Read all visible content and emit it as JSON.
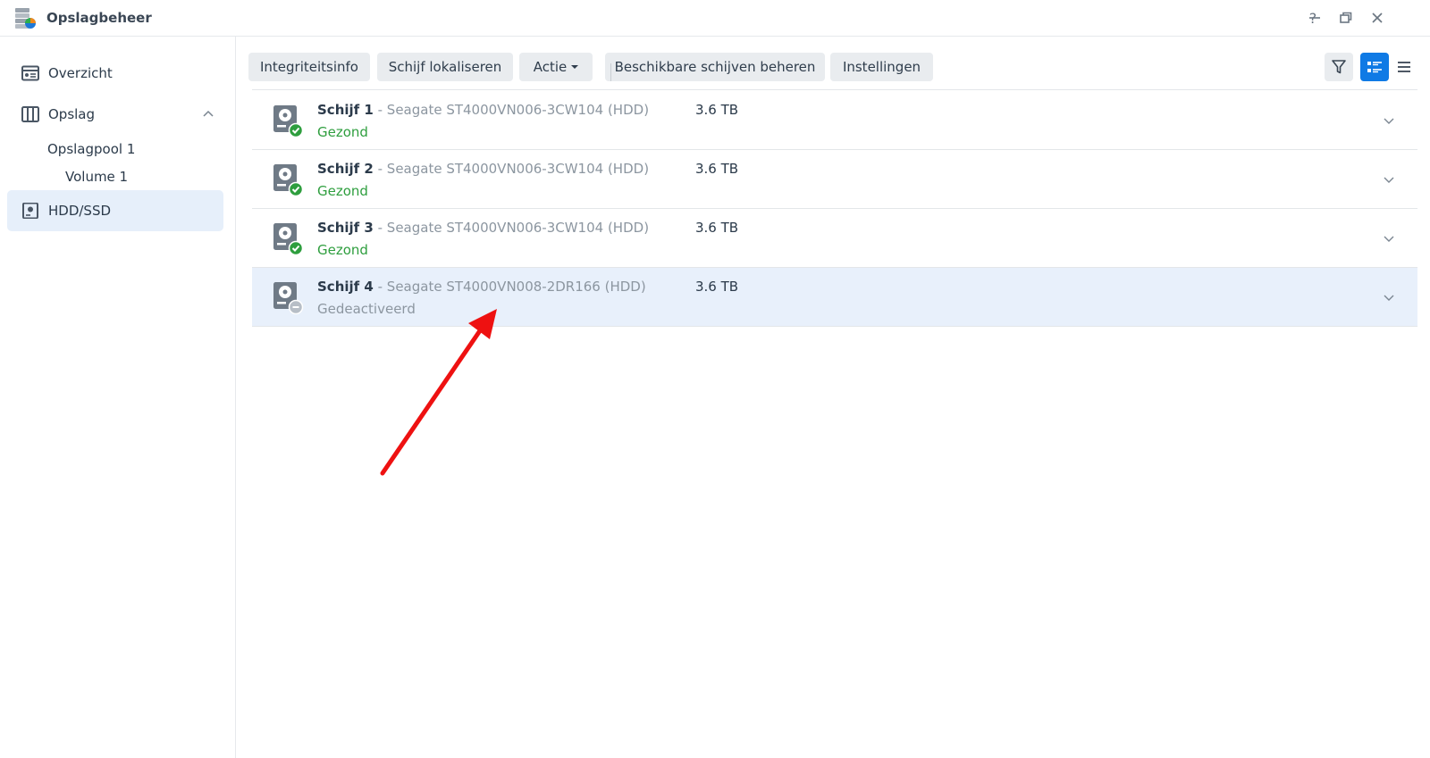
{
  "window": {
    "title": "Opslagbeheer",
    "help_label": "?"
  },
  "sidebar": {
    "overview": "Overzicht",
    "storage": "Opslag",
    "pool": "Opslagpool 1",
    "volume": "Volume 1",
    "hdd": "HDD/SSD"
  },
  "toolbar": {
    "integrity": "Integriteitsinfo",
    "locate": "Schijf lokaliseren",
    "action": "Actie",
    "manage": "Beschikbare schijven beheren",
    "settings": "Instellingen"
  },
  "colors": {
    "healthy": "#2e9e3e",
    "disabled": "#8c96a0",
    "accent": "#0f7ae5",
    "arrow": "#ee1111"
  },
  "disks": [
    {
      "name": "Schijf 1",
      "model": " - Seagate ST4000VN006-3CW104 (HDD)",
      "size": "3.6 TB",
      "status": "Gezond",
      "state": "healthy"
    },
    {
      "name": "Schijf 2",
      "model": " - Seagate ST4000VN006-3CW104 (HDD)",
      "size": "3.6 TB",
      "status": "Gezond",
      "state": "healthy"
    },
    {
      "name": "Schijf 3",
      "model": " - Seagate ST4000VN006-3CW104 (HDD)",
      "size": "3.6 TB",
      "status": "Gezond",
      "state": "healthy"
    },
    {
      "name": "Schijf 4",
      "model": " - Seagate ST4000VN008-2DR166 (HDD)",
      "size": "3.6 TB",
      "status": "Gedeactiveerd",
      "state": "disabled"
    }
  ]
}
